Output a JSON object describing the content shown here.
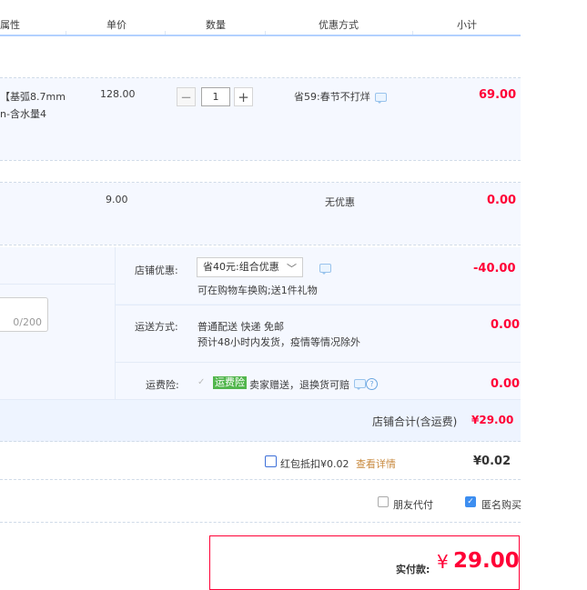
{
  "header": {
    "col_attr": "属性",
    "col_price": "单价",
    "col_qty": "数量",
    "col_promo": "优惠方式",
    "col_subtotal": "小计"
  },
  "items": [
    {
      "title_line1": "【基弧8.7mm",
      "title_line2": "n-含水量4",
      "unit_price": "128.00",
      "quantity": "1",
      "promo": "省59:春节不打烊",
      "subtotal": "69.00",
      "minus": "−",
      "plus": "+"
    },
    {
      "unit_price": "9.00",
      "promo": "无优惠",
      "subtotal": "0.00"
    }
  ],
  "order": {
    "message_counter": "0/200",
    "shop_discount_label": "店铺优惠:",
    "shop_discount_select": "省40元:组合优惠",
    "shop_discount_note": "可在购物车换购;送1件礼物",
    "shop_discount_amount": "-40.00",
    "shipping_label": "运送方式:",
    "shipping_method": "普通配送 快递 免邮",
    "shipping_note": "预计48小时内发货，疫情等情况除外",
    "shipping_amount": "0.00",
    "insurance_label": "运费险:",
    "insurance_badge": "运费险",
    "insurance_text": "卖家赠送，退换货可赔",
    "insurance_amount": "0.00",
    "shop_total_label": "店铺合计(含运费)",
    "shop_total_value": "¥29.00"
  },
  "redpacket": {
    "label": "红包抵扣¥0.02",
    "link": "查看详情",
    "value": "¥0.02"
  },
  "options": {
    "friend_pay": "朋友代付",
    "anonymous": "匿名购买"
  },
  "payment": {
    "label": "实付款:",
    "currency": "¥",
    "amount": "29.00"
  },
  "colors": {
    "accent_red": "#ff0036",
    "row_bg": "#f5f8ff",
    "header_line": "#b2d1ff",
    "link_orange": "#c88a3f",
    "insurance_green": "#52b64d"
  }
}
